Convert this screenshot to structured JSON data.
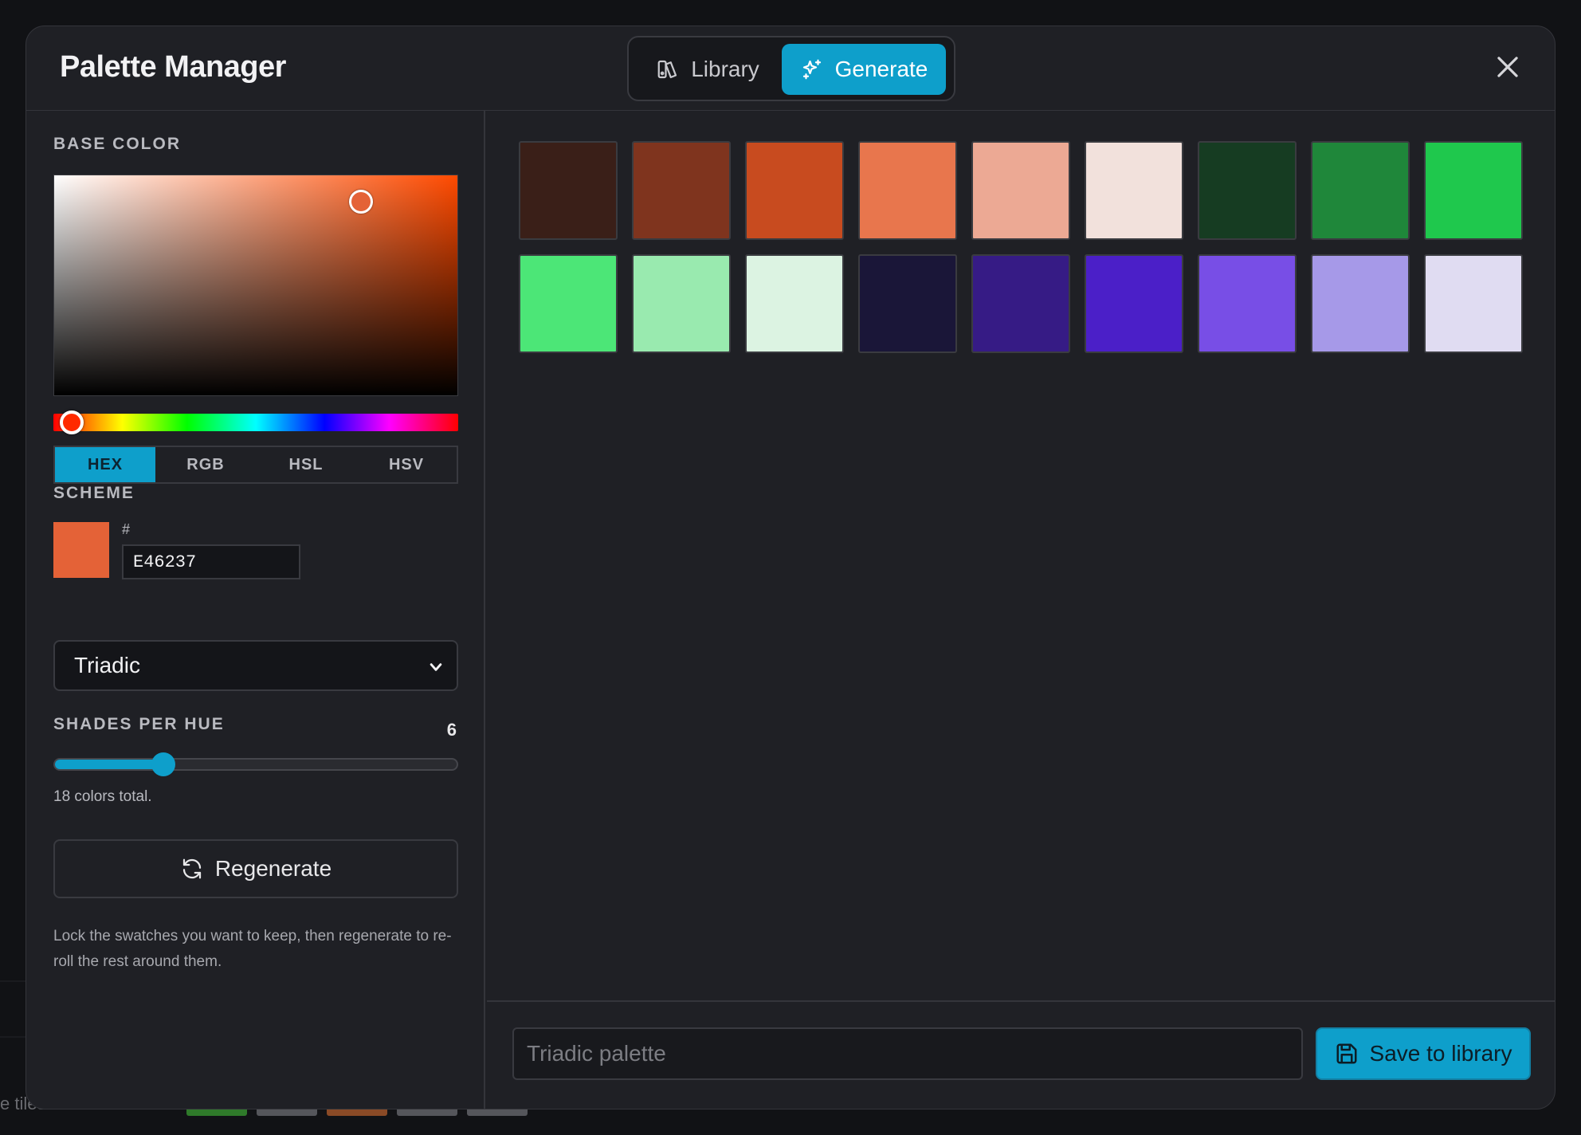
{
  "modal": {
    "title": "Palette Manager",
    "tabs": [
      {
        "label": "Library",
        "icon": "library-icon",
        "active": false
      },
      {
        "label": "Generate",
        "icon": "sparkles-icon",
        "active": true
      }
    ]
  },
  "base_color": {
    "label": "BASE COLOR",
    "formats": [
      "HEX",
      "RGB",
      "HSL",
      "HSV"
    ],
    "active_format": "HEX",
    "hash_label": "#",
    "hex_value": "E46237",
    "preview_color": "#e46237"
  },
  "scheme": {
    "label": "SCHEME",
    "selected": "Triadic"
  },
  "shades": {
    "label": "SHADES PER HUE",
    "value": "6",
    "slider_fraction": 0.27,
    "total_text": "18 colors total."
  },
  "regenerate": {
    "label": "Regenerate",
    "hint": "Lock the swatches you want to keep, then regenerate to re-roll the rest around them."
  },
  "swatches": [
    "#3a1f18",
    "#7f341e",
    "#c84b1f",
    "#e8764d",
    "#eca994",
    "#f2e1dc",
    "#163c22",
    "#1f873a",
    "#1fc84d",
    "#4ce677",
    "#99eaaf",
    "#dcf3e2",
    "#1a1638",
    "#361b85",
    "#4b1fc8",
    "#784ee6",
    "#a699e8",
    "#e0dcf2"
  ],
  "footer": {
    "name_placeholder": "Triadic palette",
    "save_label": "Save to library"
  },
  "background": {
    "partial_text": "e tiles"
  }
}
